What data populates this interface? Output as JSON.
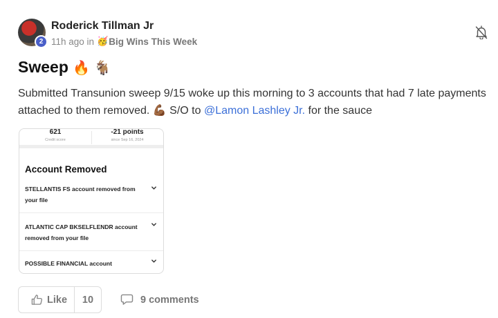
{
  "author": {
    "name": "Roderick Tillman Jr",
    "level": "2",
    "time": "11h ago in",
    "category_emoji": "🥳",
    "category": "Big Wins This Week"
  },
  "post": {
    "title": "Sweep",
    "title_emojis": "🔥 🐐",
    "body_before": "Submitted Transunion sweep 9/15 woke up this morning to 3 accounts that had 7 late payments attached to them removed. ",
    "body_emoji": "💪🏾",
    "body_mid": " S/O to ",
    "mention": "@Lamon Lashley Jr.",
    "body_after": " for the sauce"
  },
  "attachment": {
    "score_value": "621",
    "score_label": "Credit score",
    "change_value": "-21 points",
    "change_label": "since Sep 16, 2024",
    "section_title": "Account Removed",
    "accounts": [
      "STELLANTIS FS account removed from your file",
      "ATLANTIC CAP BKSELFLENDR account removed from your file",
      "POSSIBLE FINANCIAL account"
    ]
  },
  "actions": {
    "like_label": "Like",
    "like_count": "10",
    "comments_label": "9 comments"
  },
  "icons": {
    "bell": "bell-off-icon",
    "like": "thumbs-up-icon",
    "comment": "comment-icon",
    "chevron": "chevron-down-icon"
  },
  "colors": {
    "mention": "#3b6fd8",
    "level_badge": "#4a5fc9"
  }
}
